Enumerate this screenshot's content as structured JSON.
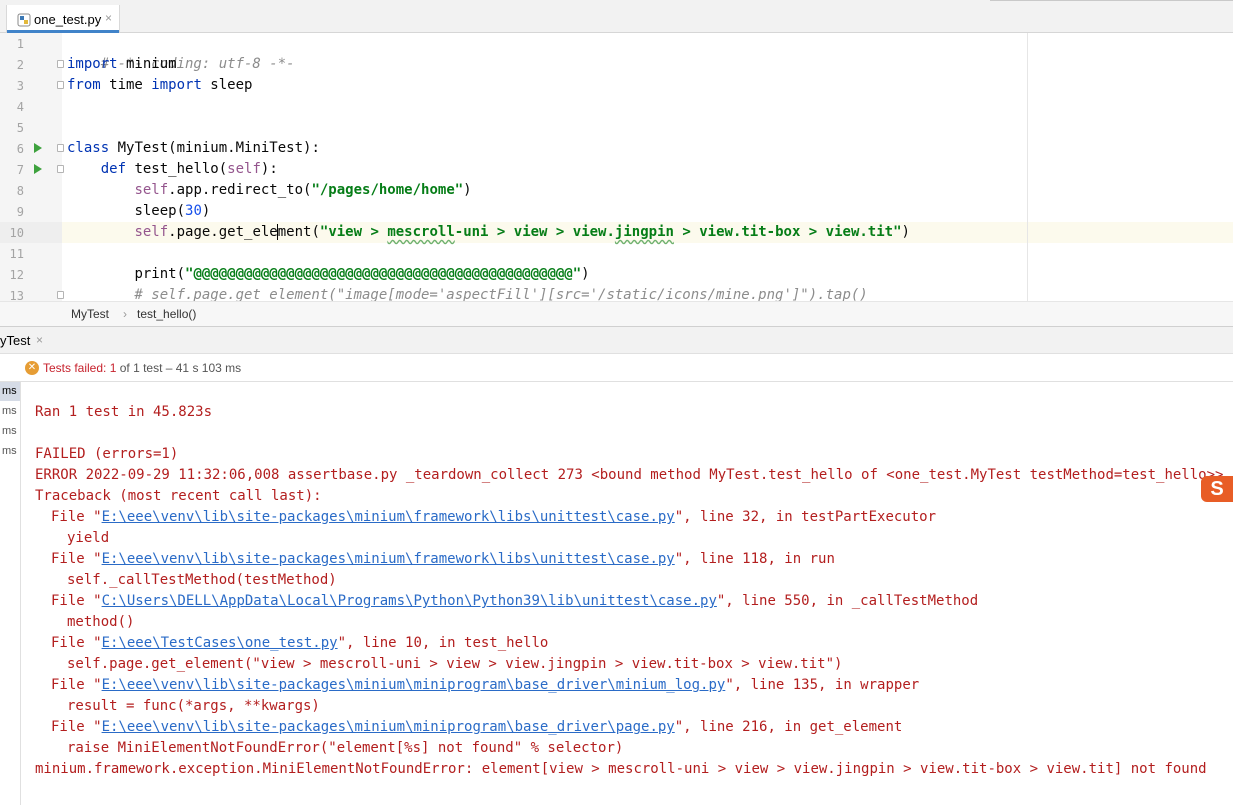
{
  "tab": {
    "filename": "one_test.py",
    "close_glyph": "×"
  },
  "editor": {
    "lines": [
      {
        "n": "1"
      },
      {
        "n": "2"
      },
      {
        "n": "3"
      },
      {
        "n": "4"
      },
      {
        "n": "5"
      },
      {
        "n": "6"
      },
      {
        "n": "7"
      },
      {
        "n": "8"
      },
      {
        "n": "9"
      },
      {
        "n": "10"
      },
      {
        "n": "11"
      },
      {
        "n": "12"
      },
      {
        "n": "13"
      }
    ],
    "code": {
      "l1": "# -*- coding: utf-8 -*-",
      "l2_kw": "import",
      "l2_rest": " minium",
      "l3_kw1": "from",
      "l3_mid": " time ",
      "l3_kw2": "import",
      "l3_rest": " sleep",
      "l6_kw": "class",
      "l6_rest": " MyTest(minium.MiniTest):",
      "l7_indent": "    ",
      "l7_kw": "def",
      "l7_name": " test_hello(",
      "l7_self": "self",
      "l7_end": "):",
      "l8_indent": "        ",
      "l8_self": "self",
      "l8_call": ".app.redirect_to(",
      "l8_str": "\"/pages/home/home\"",
      "l8_end": ")",
      "l9_indent": "        ",
      "l9_call": "sleep(",
      "l9_num": "30",
      "l9_end": ")",
      "l10_indent": "        ",
      "l10_self": "self",
      "l10_call_a": ".page.get_ele",
      "l10_call_b": "ment(",
      "l10_str_a": "\"view > ",
      "l10_str_b": "mescroll",
      "l10_str_c": "-uni > view > view.",
      "l10_str_d": "jingpin",
      "l10_str_e": " > view.tit-box > view.tit\"",
      "l10_end": ")",
      "l12_indent": "        ",
      "l12_call": "print(",
      "l12_str": "\"@@@@@@@@@@@@@@@@@@@@@@@@@@@@@@@@@@@@@@@@@@@@@\"",
      "l12_end": ")",
      "l13": "        # self.page.get_element(\"image[mode='aspectFill'][src='/static/icons/mine.png']\").tap()"
    }
  },
  "breadcrumb": {
    "class_name": "MyTest",
    "separator": "›",
    "method_name": "test_hello()"
  },
  "run": {
    "tab_name": "yTest",
    "tab_close": "×",
    "status_icon": "✕",
    "status_label": "Tests failed: ",
    "failed_count": "1",
    "status_rest": " of 1 test – 41 s 103 ms",
    "tree_items": [
      "ms",
      "ms",
      "ms",
      "ms"
    ]
  },
  "console": {
    "ran": "Ran 1 test in 45.823s",
    "failed": "FAILED (errors=1)",
    "error_line": "ERROR 2022-09-29 11:32:06,008 assertbase.py _teardown_collect 273 <bound method MyTest.test_hello of <one_test.MyTest testMethod=test_hello>>",
    "traceback": "Traceback (most recent call last):",
    "frames": [
      {
        "pre": "File \"",
        "path": "E:\\eee\\venv\\lib\\site-packages\\minium\\framework\\libs\\unittest\\case.py",
        "post": "\", line 32, in testPartExecutor",
        "code": "yield"
      },
      {
        "pre": "File \"",
        "path": "E:\\eee\\venv\\lib\\site-packages\\minium\\framework\\libs\\unittest\\case.py",
        "post": "\", line 118, in run",
        "code": "self._callTestMethod(testMethod)"
      },
      {
        "pre": "File \"",
        "path": "C:\\Users\\DELL\\AppData\\Local\\Programs\\Python\\Python39\\lib\\unittest\\case.py",
        "post": "\", line 550, in _callTestMethod",
        "code": "method()"
      },
      {
        "pre": "File \"",
        "path": "E:\\eee\\TestCases\\one_test.py",
        "post": "\", line 10, in test_hello",
        "code": "self.page.get_element(\"view > mescroll-uni > view > view.jingpin > view.tit-box > view.tit\")"
      },
      {
        "pre": "File \"",
        "path": "E:\\eee\\venv\\lib\\site-packages\\minium\\miniprogram\\base_driver\\minium_log.py",
        "post": "\", line 135, in wrapper",
        "code": "result = func(*args, **kwargs)"
      },
      {
        "pre": "File \"",
        "path": "E:\\eee\\venv\\lib\\site-packages\\minium\\miniprogram\\base_driver\\page.py",
        "post": "\", line 216, in get_element",
        "code": "raise MiniElementNotFoundError(\"element[%s] not found\" % selector)"
      }
    ],
    "exception": "minium.framework.exception.MiniElementNotFoundError: element[view > mescroll-uni > view > view.jingpin > view.tit-box > view.tit] not found"
  },
  "ime": {
    "glyph": "S"
  }
}
